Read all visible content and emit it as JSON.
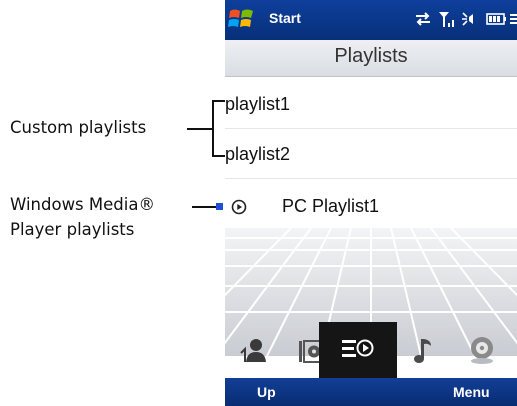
{
  "annotations": {
    "custom": "Custom playlists",
    "wmp_line1": "Windows Media®",
    "wmp_line2": "Player playlists"
  },
  "status_bar": {
    "start_label": "Start",
    "icons": [
      "windows-logo-icon",
      "connectivity-icon",
      "signal-icon",
      "volume-icon",
      "battery-icon",
      "menu-lines-icon"
    ]
  },
  "header": {
    "title": "Playlists"
  },
  "playlists": [
    {
      "label": "playlist1"
    },
    {
      "label": "playlist2"
    },
    {
      "label": "PC Playlist1",
      "icon": "play-circle-icon"
    }
  ],
  "tabs": [
    {
      "name": "artists-tab",
      "icon": "person-icon",
      "active": false
    },
    {
      "name": "albums-tab",
      "icon": "album-icon",
      "active": false
    },
    {
      "name": "playlists-tab",
      "icon": "playlist-icon",
      "active": true
    },
    {
      "name": "songs-tab",
      "icon": "music-note-icon",
      "active": false
    },
    {
      "name": "now-playing-tab",
      "icon": "disc-icon",
      "active": false
    }
  ],
  "softkeys": {
    "left": "Up",
    "right": "Menu"
  }
}
